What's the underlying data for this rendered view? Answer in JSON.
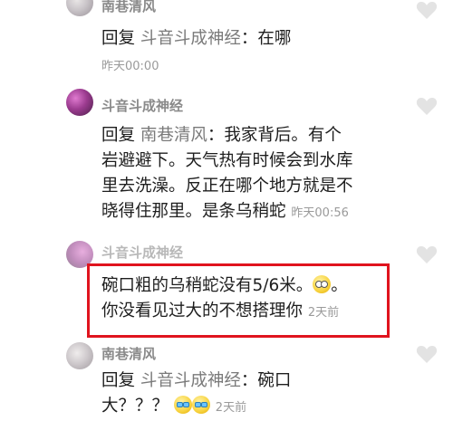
{
  "comments": [
    {
      "username": "南巷清风",
      "reply_prefix": "回复",
      "mention": "斗音斗成神经",
      "text_parts": [
        "：在哪"
      ],
      "time": "昨天00:00"
    },
    {
      "username": "斗音斗成神经",
      "reply_prefix": "回复",
      "mention": "南巷清风",
      "text_parts": [
        "：我家背后。有个",
        "岩避避下。天气热有时候会到水库",
        "里去洗澡。反正在哪个地方就是不",
        "晓得住那里。是条乌稍蛇"
      ],
      "time": "昨天00:56"
    },
    {
      "username": "斗音斗成神经",
      "text_parts": [
        "碗口粗的乌稍蛇没有5/6米。",
        "。",
        "你没看见过大的不想搭理你"
      ],
      "time": "2天前",
      "emoji": "astonished-emoji"
    },
    {
      "username": "南巷清风",
      "reply_prefix": "回复",
      "mention": "斗音斗成神经",
      "text_parts": [
        "：碗口",
        "大？？？"
      ],
      "time": "2天前",
      "emoji": "laughing-tears-emoji"
    }
  ],
  "colors": {
    "username": "#8a8a8a",
    "mention": "#7a7a7a",
    "time": "#9a9a9a",
    "highlight": "#e0141e"
  }
}
